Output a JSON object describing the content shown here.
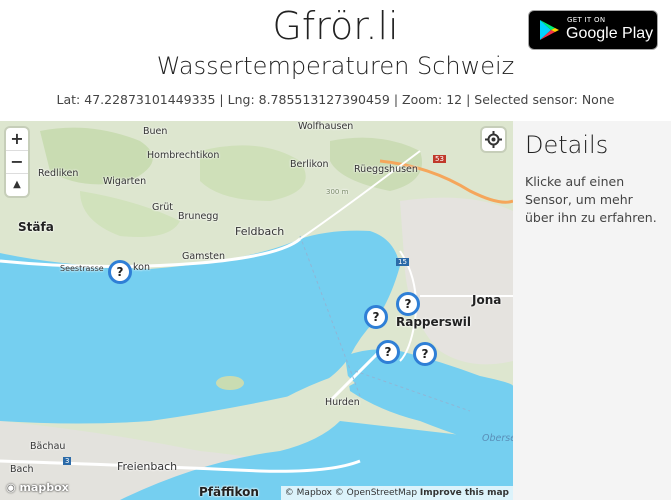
{
  "header": {
    "title": "Gfrör.li",
    "subtitle": "Wassertemperaturen Schweiz",
    "status": "Lat: 47.22873101449335 | Lng: 8.785513127390459 | Zoom: 12 | Selected sensor: None",
    "store_badge": {
      "small": "GET IT ON",
      "big": "Google Play"
    }
  },
  "map": {
    "controls": {
      "zoom_in": "+",
      "zoom_out": "−",
      "compass": "▲"
    },
    "labels": {
      "wolfhausen": "Wolfhausen",
      "buen": "Buen",
      "hombrechtikon": "Hombrechtikon",
      "berlikon": "Berlikon",
      "rueggeshusen": "Rüeggshusen",
      "redliken": "Redliken",
      "wigarten": "Wigarten",
      "grut": "Grüt",
      "brunegg": "Brunegg",
      "stafa": "Stäfa",
      "feldbach": "Feldbach",
      "gamsten": "Gamsten",
      "seestrasse": "Seestrasse",
      "kon": "kon",
      "jona": "Jona",
      "rapperswil": "Rapperswil",
      "hurden": "Hurden",
      "obersee": "Oberse",
      "bachau": "Bächau",
      "bach": "Bach",
      "freienbach": "Freienbach",
      "pfaffikon": "Pfäffikon",
      "route15": "15",
      "route53": "53",
      "route3": "3",
      "elev": "300 m"
    },
    "sensors": [
      "?",
      "?",
      "?",
      "?",
      "?"
    ],
    "attribution": {
      "mapbox": "© Mapbox",
      "osm": "© OpenStreetMap",
      "improve": "Improve this map"
    },
    "logo": "mapbox"
  },
  "details": {
    "heading": "Details",
    "text": "Klicke auf einen Sensor, um mehr über ihn zu erfahren."
  }
}
